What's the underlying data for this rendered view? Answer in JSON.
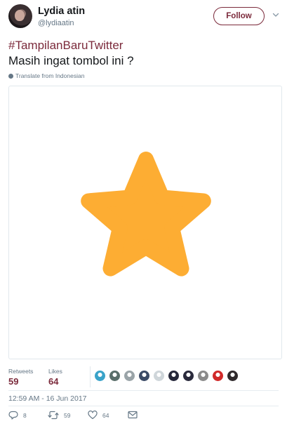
{
  "user": {
    "name": "Lydia atin",
    "handle": "@lydiaatin"
  },
  "follow_label": "Follow",
  "tweet": {
    "hashtag": "#TampilanBaruTwitter",
    "text": "Masih ingat tombol ini ?",
    "translate": "Translate from Indonesian",
    "media_icon": "star-icon",
    "star_color": "#fdad33"
  },
  "stats": {
    "retweets_label": "Retweets",
    "retweets": "59",
    "likes_label": "Likes",
    "likes": "64"
  },
  "liker_colors": [
    "#3aa3c9",
    "#5a6e6a",
    "#9aa4a8",
    "#3b4b66",
    "#cfd6da",
    "#26283a",
    "#2a2a3c",
    "#8b8b8b",
    "#d12a2a",
    "#2f2a2c"
  ],
  "timestamp": "12:59 AM - 16 Jun 2017",
  "actions": {
    "reply_count": "8",
    "retweet_count": "59",
    "like_count": "64"
  },
  "colors": {
    "accent": "#7b2a3b",
    "muted": "#657786"
  }
}
